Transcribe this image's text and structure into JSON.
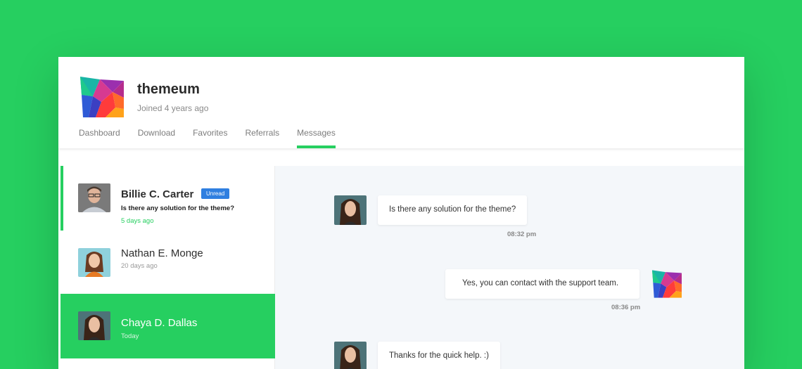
{
  "profile": {
    "name": "themeum",
    "joined": "Joined 4 years ago",
    "logo_icon": "themeum-logo-icon"
  },
  "tabs": [
    {
      "label": "Dashboard",
      "active": false
    },
    {
      "label": "Download",
      "active": false
    },
    {
      "label": "Favorites",
      "active": false
    },
    {
      "label": "Referrals",
      "active": false
    },
    {
      "label": "Messages",
      "active": true
    }
  ],
  "conversations": [
    {
      "name": "Billie C. Carter",
      "badge": "Unread",
      "preview": "Is there any solution for the theme?",
      "time": "5 days ago",
      "unread": true
    },
    {
      "name": "Nathan E. Monge",
      "time": "20 days ago"
    },
    {
      "name": "Chaya D. Dallas",
      "time": "Today",
      "selected": true
    }
  ],
  "messages": [
    {
      "text": "Is there any solution for the theme?",
      "time": "08:32 pm",
      "from": "contact"
    },
    {
      "text": "Yes, you can contact with the support team.",
      "time": "08:36 pm",
      "from": "me"
    },
    {
      "text": "Thanks for the quick help. :)",
      "from": "contact"
    }
  ],
  "colors": {
    "accent": "#26cf60",
    "badge": "#2f7fe0",
    "chat_bg": "#f4f7fa"
  }
}
